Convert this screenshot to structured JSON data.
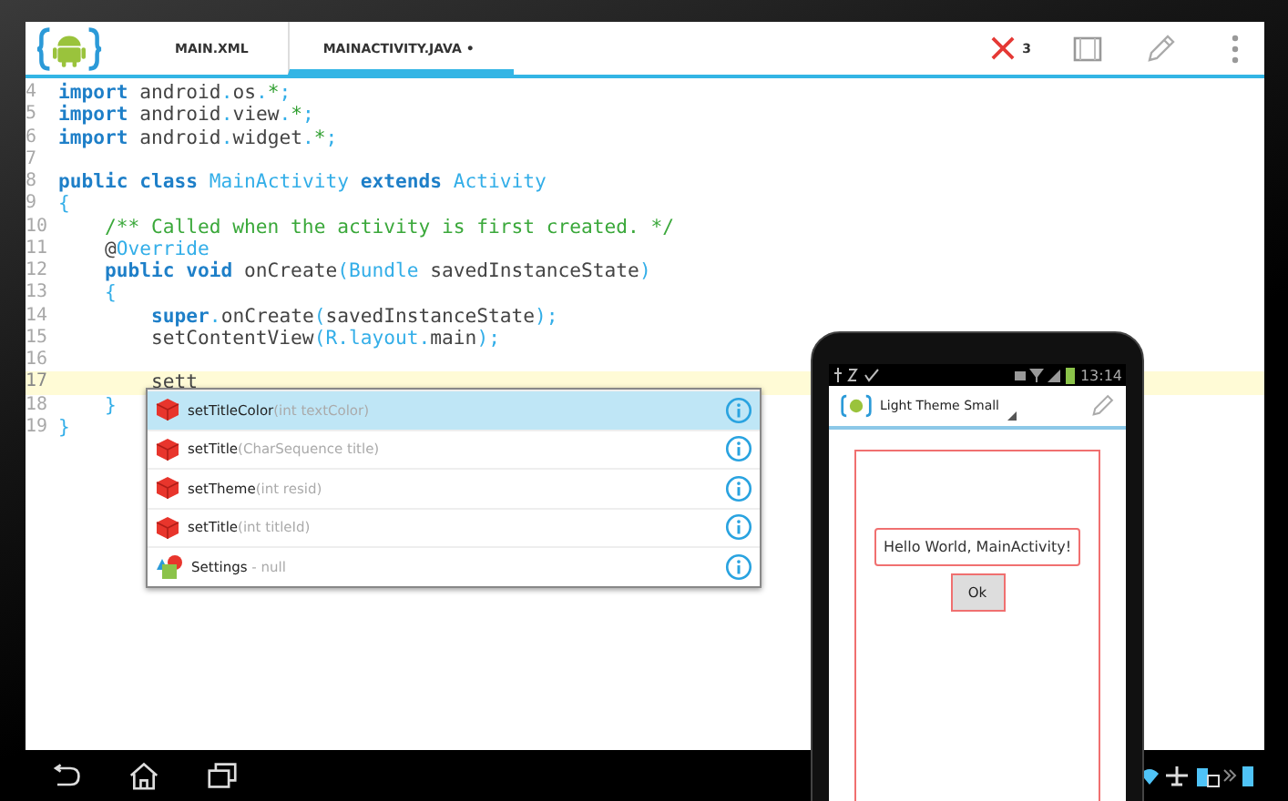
{
  "tabs": [
    {
      "label": "MAIN.XML",
      "selected": false
    },
    {
      "label": "MAINACTIVITY.JAVA •",
      "selected": true
    }
  ],
  "error_count": "3",
  "code_lines": [
    {
      "number": "4",
      "current": false,
      "tokens": [
        {
          "kind": "keyword",
          "text": "import"
        },
        {
          "kind": "plain",
          "text": " android"
        },
        {
          "kind": "punct",
          "text": "."
        },
        {
          "kind": "plain",
          "text": "os"
        },
        {
          "kind": "punct",
          "text": "."
        },
        {
          "kind": "op",
          "text": "*"
        },
        {
          "kind": "punct",
          "text": ";"
        }
      ]
    },
    {
      "number": "5",
      "current": false,
      "tokens": [
        {
          "kind": "keyword",
          "text": "import"
        },
        {
          "kind": "plain",
          "text": " android"
        },
        {
          "kind": "punct",
          "text": "."
        },
        {
          "kind": "plain",
          "text": "view"
        },
        {
          "kind": "punct",
          "text": "."
        },
        {
          "kind": "op",
          "text": "*"
        },
        {
          "kind": "punct",
          "text": ";"
        }
      ]
    },
    {
      "number": "6",
      "current": false,
      "tokens": [
        {
          "kind": "keyword",
          "text": "import"
        },
        {
          "kind": "plain",
          "text": " android"
        },
        {
          "kind": "punct",
          "text": "."
        },
        {
          "kind": "plain",
          "text": "widget"
        },
        {
          "kind": "punct",
          "text": "."
        },
        {
          "kind": "op",
          "text": "*"
        },
        {
          "kind": "punct",
          "text": ";"
        }
      ]
    },
    {
      "number": "7",
      "current": false
    },
    {
      "number": "8",
      "current": false,
      "tokens": [
        {
          "kind": "keyword",
          "text": "public class"
        },
        {
          "kind": "type",
          "text": " MainActivity"
        },
        {
          "kind": "keyword",
          "text": " extends"
        },
        {
          "kind": "type",
          "text": " Activity"
        }
      ]
    },
    {
      "number": "9",
      "current": false,
      "tokens": [
        {
          "kind": "punct",
          "text": "{"
        }
      ]
    },
    {
      "number": "10",
      "current": false,
      "tokens": [
        {
          "kind": "comment",
          "text": "    /** Called when the activity is first created. */"
        }
      ]
    },
    {
      "number": "11",
      "current": false,
      "tokens": [
        {
          "kind": "plain",
          "text": "    @"
        },
        {
          "kind": "type",
          "text": "Override"
        }
      ]
    },
    {
      "number": "12",
      "current": false,
      "tokens": [
        {
          "kind": "keyword",
          "text": "    public void"
        },
        {
          "kind": "plain",
          "text": " onCreate"
        },
        {
          "kind": "punct",
          "text": "("
        },
        {
          "kind": "type",
          "text": "Bundle"
        },
        {
          "kind": "plain",
          "text": " savedInstanceState"
        },
        {
          "kind": "punct",
          "text": ")"
        }
      ]
    },
    {
      "number": "13",
      "current": false,
      "tokens": [
        {
          "kind": "punct",
          "text": "    {"
        }
      ]
    },
    {
      "number": "14",
      "current": false,
      "tokens": [
        {
          "kind": "keyword",
          "text": "        super"
        },
        {
          "kind": "punct",
          "text": "."
        },
        {
          "kind": "plain",
          "text": "onCreate"
        },
        {
          "kind": "punct",
          "text": "("
        },
        {
          "kind": "plain",
          "text": "savedInstanceState"
        },
        {
          "kind": "punct",
          "text": ");"
        }
      ]
    },
    {
      "number": "15",
      "current": false,
      "tokens": [
        {
          "kind": "plain",
          "text": "        setContentView"
        },
        {
          "kind": "punct",
          "text": "("
        },
        {
          "kind": "type",
          "text": "R"
        },
        {
          "kind": "punct",
          "text": "."
        },
        {
          "kind": "type",
          "text": "layout"
        },
        {
          "kind": "punct",
          "text": "."
        },
        {
          "kind": "plain",
          "text": "main"
        },
        {
          "kind": "punct",
          "text": ");"
        }
      ]
    },
    {
      "number": "16",
      "current": false
    },
    {
      "number": "17",
      "current": true,
      "tokens": [
        {
          "kind": "error",
          "text": "        sett"
        }
      ]
    },
    {
      "number": "18",
      "current": false,
      "tokens": [
        {
          "kind": "punct",
          "text": "    }"
        }
      ]
    },
    {
      "number": "19",
      "current": false,
      "tokens": [
        {
          "kind": "punct",
          "text": "}"
        }
      ]
    }
  ],
  "completions": [
    {
      "kind": "method",
      "name": "setTitleColor",
      "detail": "(int textColor)",
      "selected": true
    },
    {
      "kind": "method",
      "name": "setTitle",
      "detail": "(CharSequence title)",
      "selected": false
    },
    {
      "kind": "method",
      "name": "setTheme",
      "detail": "(int resid)",
      "selected": false
    },
    {
      "kind": "method",
      "name": "setTitle",
      "detail": "(int titleId)",
      "selected": false
    },
    {
      "kind": "class",
      "name": "Settings",
      "detail": " - null",
      "selected": false
    }
  ],
  "phone": {
    "time": "13:14",
    "theme": "Light Theme Small",
    "text": "Hello World, MainActivity!",
    "button": "Ok"
  }
}
